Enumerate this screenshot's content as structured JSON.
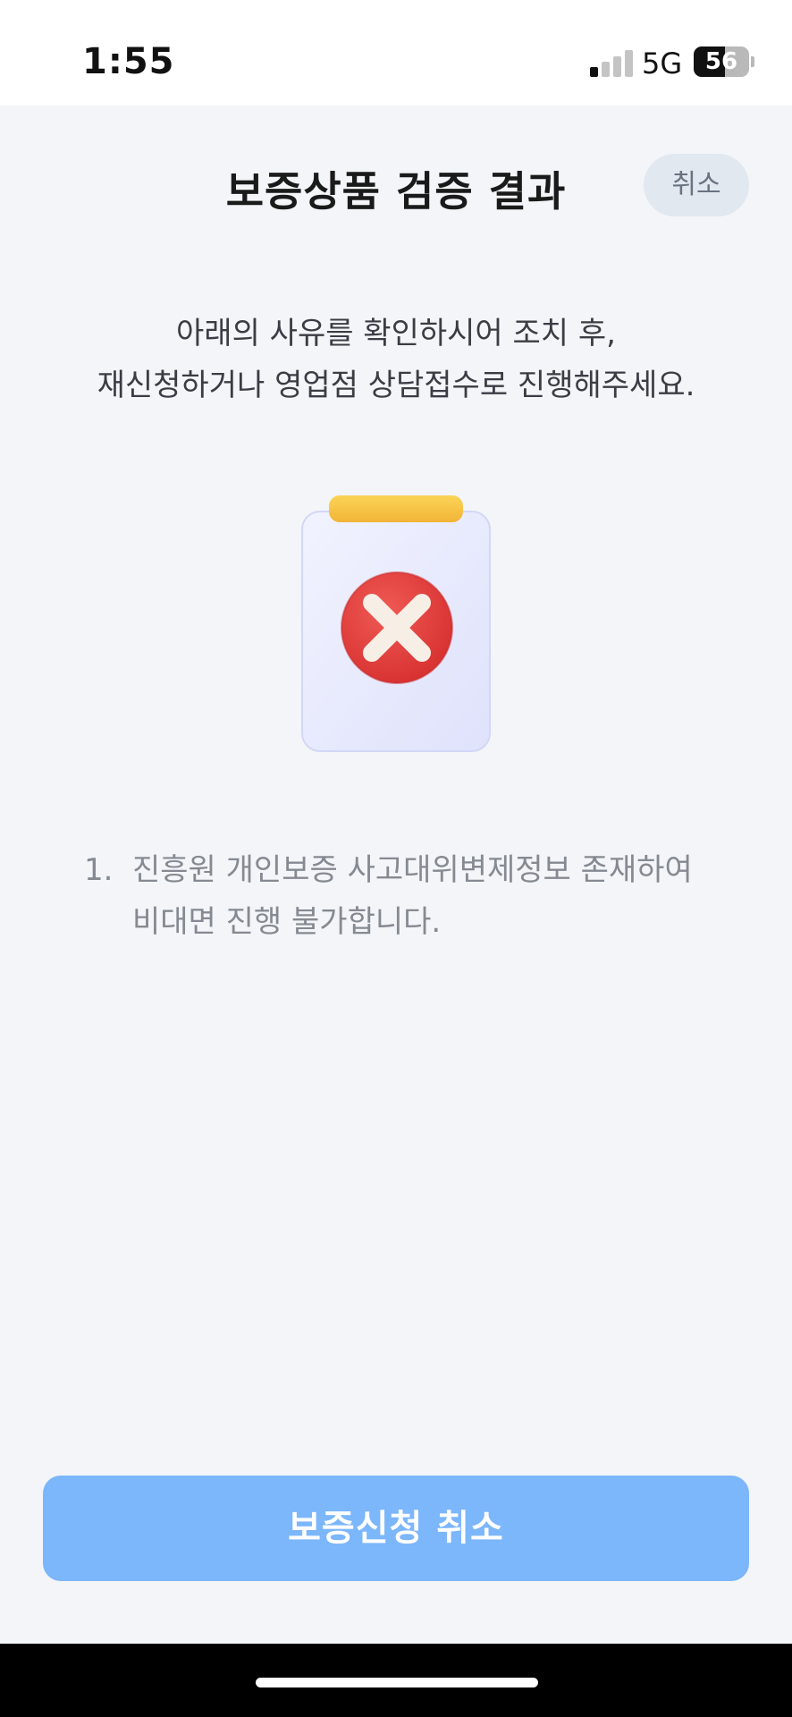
{
  "status_bar": {
    "time": "1:55",
    "network": "5G",
    "battery": "56",
    "battery_level": 0.56,
    "signal_bars_active": 1,
    "signal_bars_total": 4
  },
  "header": {
    "title": "보증상품 검증 결과",
    "cancel_label": "취소"
  },
  "message": {
    "line1": "아래의 사유를 확인하시어 조치 후,",
    "line2": "재신청하거나 영업점 상담접수로 진행해주세요."
  },
  "illustration": {
    "icon": "clipboard-error-icon"
  },
  "reasons": [
    {
      "number": "1.",
      "line1": "진흥원 개인보증 사고대위변제정보 존재하여",
      "line2": "비대면 진행 불가합니다."
    }
  ],
  "footer": {
    "button_label": "보증신청 취소"
  },
  "colors": {
    "background": "#f3f5f8",
    "primary_button": "#7cb6fb",
    "header_cancel_bg": "#e1e8f0",
    "error_red": "#e23d3d",
    "clip_yellow": "#f7c645"
  }
}
